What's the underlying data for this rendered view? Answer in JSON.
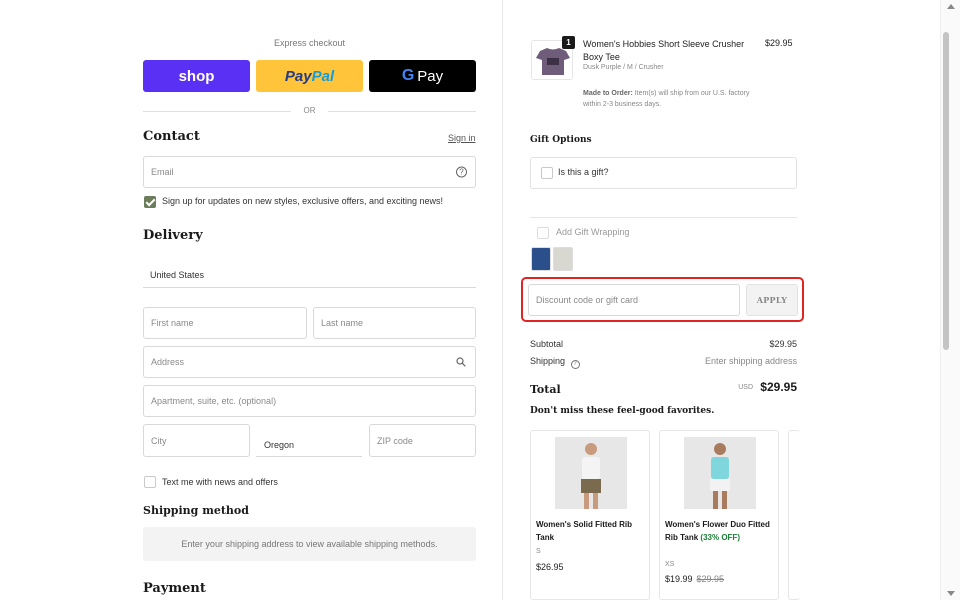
{
  "express": {
    "label": "Express checkout",
    "shop_label": "shop",
    "paypal_part1": "Pay",
    "paypal_part2": "Pal",
    "gpay_g": "G",
    "gpay_label": "Pay",
    "or_label": "OR"
  },
  "contact": {
    "title": "Contact",
    "signin_label": "Sign in",
    "email_placeholder": "Email",
    "newsletter_label": "Sign up for updates on new styles, exclusive offers, and exciting news!",
    "newsletter_checked": true
  },
  "delivery": {
    "title": "Delivery",
    "country": "United States",
    "first_name_placeholder": "First name",
    "last_name_placeholder": "Last name",
    "address_placeholder": "Address",
    "apartment_placeholder": "Apartment, suite, etc. (optional)",
    "city_placeholder": "City",
    "state": "Oregon",
    "zip_placeholder": "ZIP code",
    "text_me_label": "Text me with news and offers"
  },
  "shipping_method": {
    "title": "Shipping method",
    "message": "Enter your shipping address to view available shipping methods."
  },
  "payment": {
    "title": "Payment"
  },
  "order": {
    "product": {
      "quantity": "1",
      "name": "Women's Hobbies Short Sleeve Crusher Boxy Tee",
      "variant": "Dusk Purple / M / Crusher",
      "price": "$29.95",
      "note_bold": "Made to Order:",
      "note_text": " Item(s) will ship from our U.S. factory within 2-3 business days."
    },
    "gift_options_title": "Gift Options",
    "is_gift_label": "Is this a gift?",
    "gift_wrapping_label": "Add Gift Wrapping",
    "discount_placeholder": "Discount code or gift card",
    "apply_label": "APPLY",
    "subtotal_label": "Subtotal",
    "subtotal_value": "$29.95",
    "shipping_label": "Shipping",
    "shipping_value": "Enter shipping address",
    "total_label": "Total",
    "total_currency": "USD",
    "total_value": "$29.95"
  },
  "favorites": {
    "title": "Don't miss these feel-good favorites.",
    "cards": [
      {
        "name": "Women's Solid Fitted Rib Tank",
        "size": "S",
        "price": "$26.95"
      },
      {
        "name": "Women's Flower Duo Fitted Rib Tank",
        "discount": "(33% OFF)",
        "size": "XS",
        "price": "$19.99",
        "old_price": "$29.95"
      }
    ]
  },
  "colors": {
    "shop": "#5a31f4",
    "paypal": "#ffc439",
    "gpay": "#000000",
    "checkbox_checked": "#6b7d5a",
    "highlight": "#e02424",
    "discount_green": "#1a7f37"
  }
}
